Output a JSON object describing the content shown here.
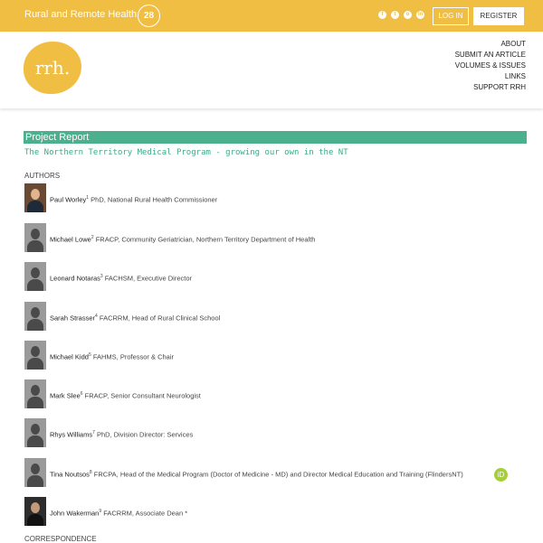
{
  "topbar": {
    "site_title": "Rural and Remote Health",
    "badge": "28",
    "social": [
      {
        "icon": "facebook-icon",
        "glyph": "f"
      },
      {
        "icon": "twitter-icon",
        "glyph": "t"
      },
      {
        "icon": "instagram-icon",
        "glyph": "o"
      },
      {
        "icon": "linkedin-icon",
        "glyph": "in"
      }
    ],
    "login": "LOG IN",
    "register": "REGISTER"
  },
  "header": {
    "logo": "rrh.",
    "nav": [
      "ABOUT",
      "SUBMIT AN ARTICLE",
      "VOLUMES & ISSUES",
      "LINKS",
      "SUPPORT RRH"
    ]
  },
  "article": {
    "section": "Project Report",
    "title": "The Northern Territory Medical Program - growing our own in the NT",
    "authors_heading": "AUTHORS",
    "authors": [
      {
        "name": "Paul Worley",
        "sup": "1",
        "affil": " PhD, National Rural Health Commissioner"
      },
      {
        "name": "Michael Lowe",
        "sup": "2",
        "affil": " FRACP, Community Geriatrician, Northern Territory Department of Health"
      },
      {
        "name": "Leonard Notaras",
        "sup": "3",
        "affil": " FACHSM, Executive Director"
      },
      {
        "name": "Sarah Strasser",
        "sup": "4",
        "affil": " FACRRM, Head of Rural Clinical School"
      },
      {
        "name": "Michael Kidd",
        "sup": "5",
        "affil": " FAHMS, Professor & Chair"
      },
      {
        "name": "Mark Slee",
        "sup": "6",
        "affil": " FRACP, Senior Consultant Neurologist"
      },
      {
        "name": "Rhys Williams",
        "sup": "7",
        "affil": " PhD, Division Director: Services"
      },
      {
        "name": "Tina Noutsos",
        "sup": "8",
        "affil": " FRCPA, Head of the Medical Program (Doctor of Medicine - MD) and Director Medical Education and Training (FlindersNT)"
      },
      {
        "name": "John Wakerman",
        "sup": "9",
        "affil": " FACRRM, Associate Dean *"
      }
    ],
    "orcid": "iD",
    "correspondence": "CORRESPONDENCE"
  }
}
